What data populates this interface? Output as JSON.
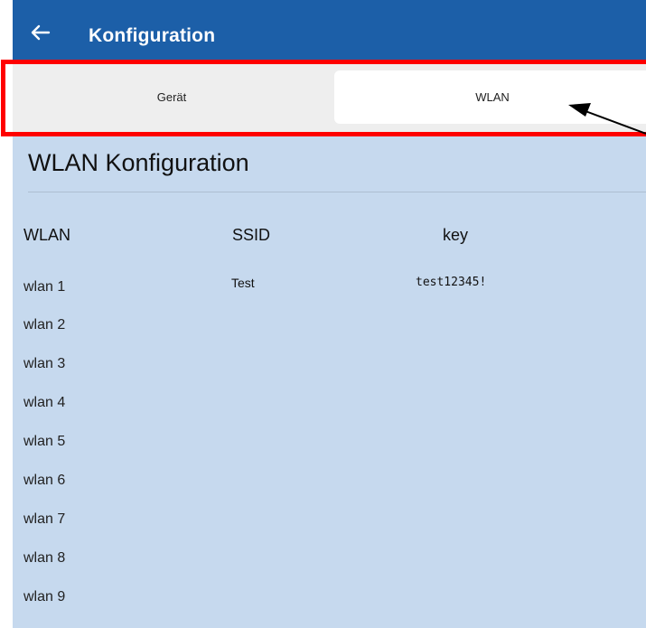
{
  "appbar": {
    "title": "Konfiguration",
    "back_icon": "arrow-left-icon",
    "background": "#1c5fa8"
  },
  "tabs": [
    {
      "label": "Gerät",
      "selected": false
    },
    {
      "label": "WLAN",
      "selected": true
    }
  ],
  "section": {
    "title": "WLAN Konfiguration"
  },
  "table": {
    "headers": {
      "wlan": "WLAN",
      "ssid": "SSID",
      "key": "key"
    },
    "rows": [
      {
        "name": "wlan 1",
        "ssid": "Test",
        "key": "test12345!"
      },
      {
        "name": "wlan 2",
        "ssid": "",
        "key": ""
      },
      {
        "name": "wlan 3",
        "ssid": "",
        "key": ""
      },
      {
        "name": "wlan 4",
        "ssid": "",
        "key": ""
      },
      {
        "name": "wlan 5",
        "ssid": "",
        "key": ""
      },
      {
        "name": "wlan 6",
        "ssid": "",
        "key": ""
      },
      {
        "name": "wlan 7",
        "ssid": "",
        "key": ""
      },
      {
        "name": "wlan 8",
        "ssid": "",
        "key": ""
      },
      {
        "name": "wlan 9",
        "ssid": "",
        "key": ""
      }
    ]
  },
  "colors": {
    "content_background": "#c6d9ee",
    "annotation_box": "#ff0000",
    "annotation_arrow": "#000000"
  }
}
